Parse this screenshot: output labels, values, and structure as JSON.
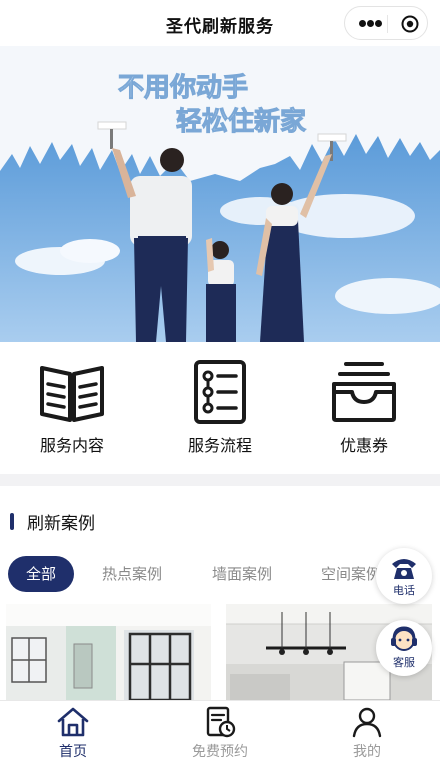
{
  "header": {
    "title": "圣代刷新服务"
  },
  "banner": {
    "headline_1": "不用你动手",
    "headline_2": "轻松住新家"
  },
  "quick_menu": [
    {
      "label": "服务内容",
      "icon": "book-icon"
    },
    {
      "label": "服务流程",
      "icon": "flow-list-icon"
    },
    {
      "label": "优惠券",
      "icon": "coupon-tray-icon"
    }
  ],
  "section": {
    "title": "刷新案例"
  },
  "tabs": [
    {
      "label": "全部",
      "active": true
    },
    {
      "label": "热点案例",
      "active": false
    },
    {
      "label": "墙面案例",
      "active": false
    },
    {
      "label": "空间案例",
      "active": false
    }
  ],
  "floating": {
    "phone_label": "电话",
    "service_label": "客服"
  },
  "tabbar": [
    {
      "label": "首页",
      "icon": "home-icon",
      "active": true
    },
    {
      "label": "免费预约",
      "icon": "appointment-icon",
      "active": false
    },
    {
      "label": "我的",
      "icon": "user-icon",
      "active": false
    }
  ],
  "colors": {
    "accent": "#1f2f6b",
    "sky": "#7fb4e6"
  }
}
